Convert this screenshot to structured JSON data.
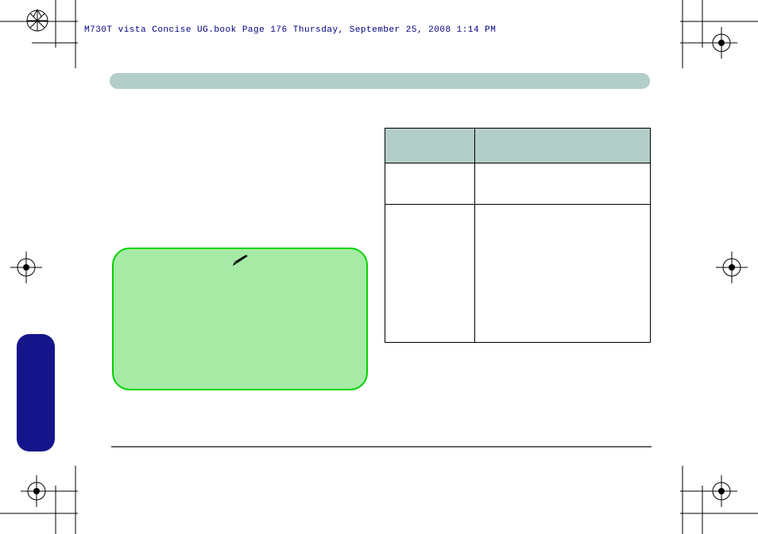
{
  "header": "M730T vista Concise UG.book  Page 176  Thursday, September 25, 2008  1:14 PM",
  "title_bar": "",
  "table": {
    "headers": [
      "",
      ""
    ],
    "rows": [
      [
        "",
        ""
      ],
      [
        "",
        ""
      ]
    ]
  },
  "note_text": "",
  "side_tab_text": ""
}
